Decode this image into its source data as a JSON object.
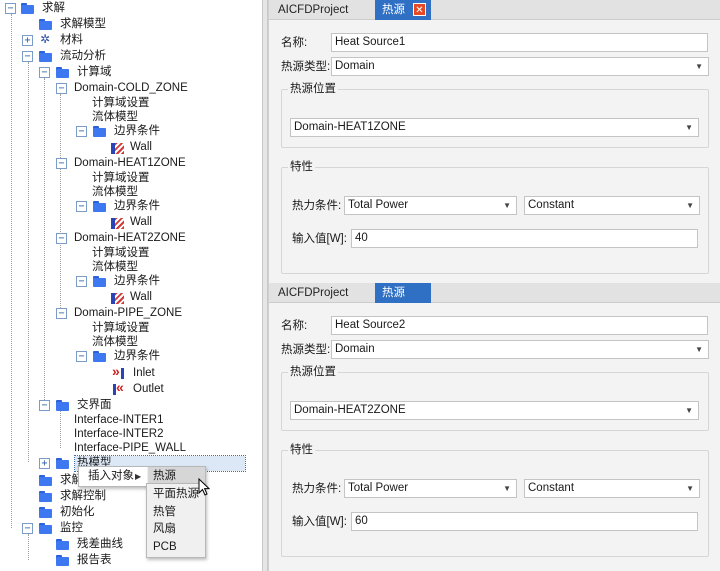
{
  "tree": {
    "root": "求解",
    "solve_model": "求解模型",
    "material": "材料",
    "flow_analysis": "流动分析",
    "compute_domain": "计算域",
    "domain_cold": "Domain-COLD_ZONE",
    "domain_heat1": "Domain-HEAT1ZONE",
    "domain_heat2": "Domain-HEAT2ZONE",
    "domain_pipe": "Domain-PIPE_ZONE",
    "domain_settings": "计算域设置",
    "fluid_model": "流体模型",
    "boundary": "边界条件",
    "wall": "Wall",
    "inlet": "Inlet",
    "outlet": "Outlet",
    "interface": "交界面",
    "inter1": "Interface-INTER1",
    "inter2": "Interface-INTER2",
    "pipe_wall": "Interface-PIPE_WALL",
    "heat_model": "热模型",
    "solve_short": "求解",
    "solve_control": "求解控制",
    "init": "初始化",
    "monitor": "监控",
    "residual": "残差曲线",
    "report": "报告表"
  },
  "context_menu": {
    "insert_object": "插入对象",
    "heat_source": "热源",
    "submenu": [
      "平面热源",
      "热管",
      "风扇",
      "PCB"
    ]
  },
  "panel1": {
    "tab_project": "AICFDProject",
    "tab_active": "热源",
    "name_label": "名称:",
    "name_value": "Heat Source1",
    "type_label": "热源类型:",
    "type_value": "Domain",
    "location_group": "热源位置",
    "location_value": "Domain-HEAT1ZONE",
    "props_group": "特性",
    "thermal_label": "热力条件:",
    "thermal_value": "Total Power",
    "mode_value": "Constant",
    "input_label": "输入值[W]:",
    "input_value": "40"
  },
  "panel2": {
    "tab_project": "AICFDProject",
    "tab_active": "热源",
    "name_label": "名称:",
    "name_value": "Heat Source2",
    "type_label": "热源类型:",
    "type_value": "Domain",
    "location_group": "热源位置",
    "location_value": "Domain-HEAT2ZONE",
    "props_group": "特性",
    "thermal_label": "热力条件:",
    "thermal_value": "Total Power",
    "mode_value": "Constant",
    "input_label": "输入值[W]:",
    "input_value": "60"
  },
  "colors": {
    "accent": "#2f6fc4",
    "close": "#e54a24",
    "folder": "#3e78f0"
  }
}
